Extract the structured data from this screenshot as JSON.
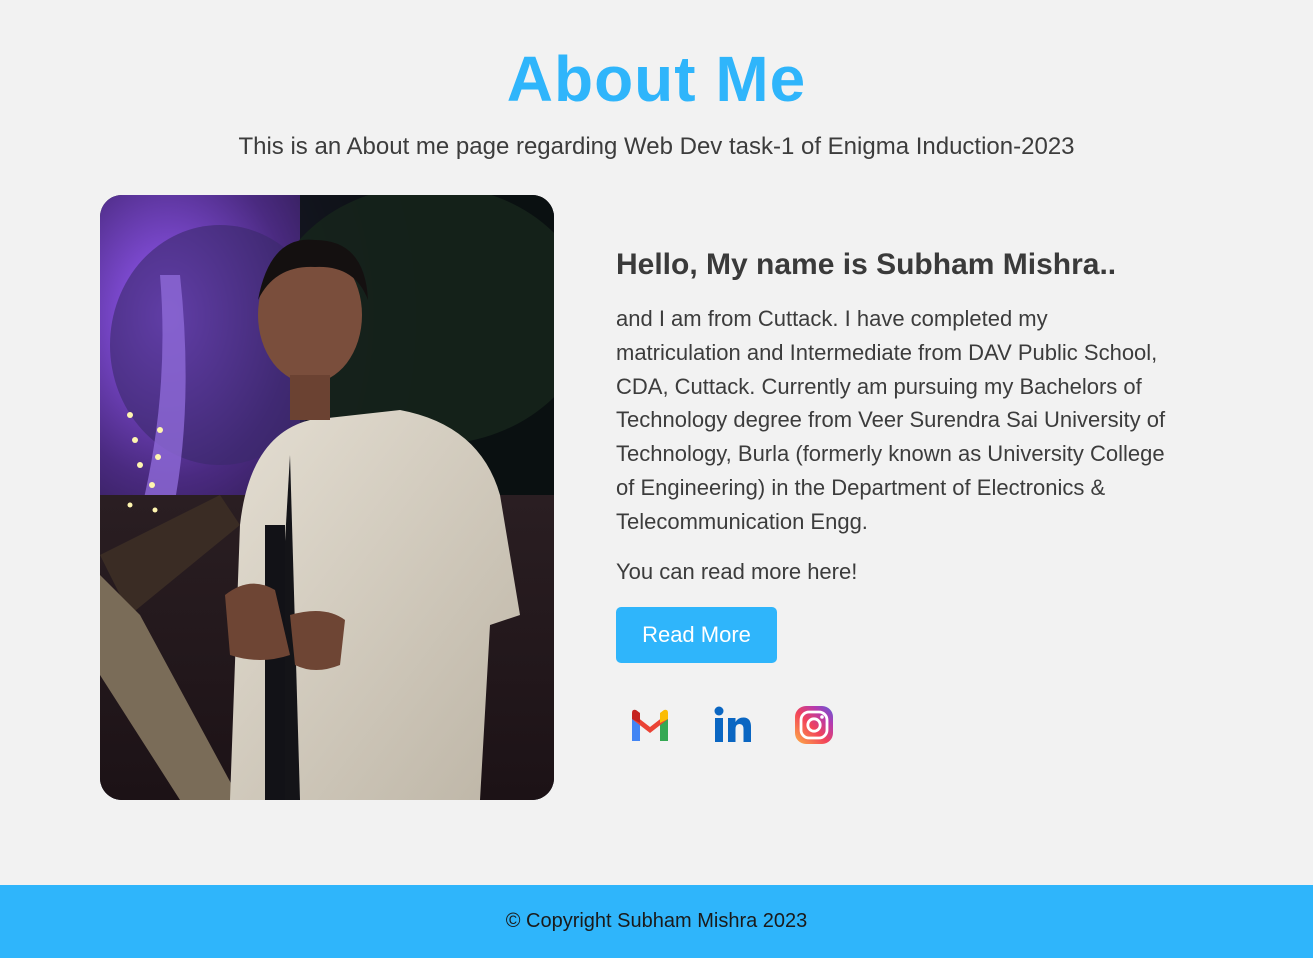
{
  "header": {
    "title": "About Me",
    "subtitle": "This is an About me page regarding Web Dev task-1 of Enigma Induction-2023"
  },
  "profile": {
    "greeting": "Hello, My name is Subham Mishra..",
    "bio": "and I am from Cuttack. I have completed my matriculation and Intermediate from DAV Public School, CDA, Cuttack. Currently am pursuing my Bachelors of Technology degree from Veer Surendra Sai University of Technology, Burla (formerly known as University College of Engineering) in the Department of Electronics & Telecommunication Engg.",
    "read_more_text": "You can read more here!",
    "read_more_label": "Read More"
  },
  "socials": [
    {
      "icon": "gmail-icon"
    },
    {
      "icon": "linkedin-icon"
    },
    {
      "icon": "instagram-icon"
    }
  ],
  "footer": {
    "copyright": "© Copyright Subham Mishra 2023"
  },
  "colors": {
    "accent": "#2fb5fb",
    "background": "#f2f2f2",
    "text": "#3a3a3a"
  }
}
